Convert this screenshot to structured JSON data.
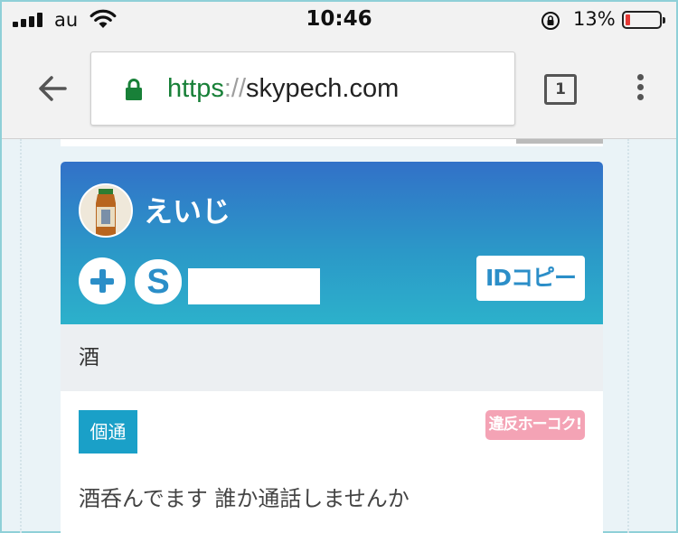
{
  "status_bar": {
    "carrier": "au",
    "time": "10:46",
    "battery_percent": "13%",
    "battery_level": 0.13,
    "colors": {
      "battery_low": "#e53935"
    }
  },
  "browser": {
    "url_scheme": "https",
    "url_separator": "://",
    "url_host": "skypech.com",
    "tab_count": "1",
    "colors": {
      "secure": "#188038"
    }
  },
  "post": {
    "username": "えいじ",
    "skype_symbol": "S",
    "copy_id_label": "IDコピー",
    "category": "酒",
    "tag": "個通",
    "report_label": "違反ホーコク!",
    "message": "酒呑んでます 誰か通話しませんか",
    "colors": {
      "header_top": "#3271c8",
      "header_bottom": "#2cb1cb",
      "tag_bg": "#1aa0c8",
      "report_bg": "#f4a3b5"
    }
  }
}
